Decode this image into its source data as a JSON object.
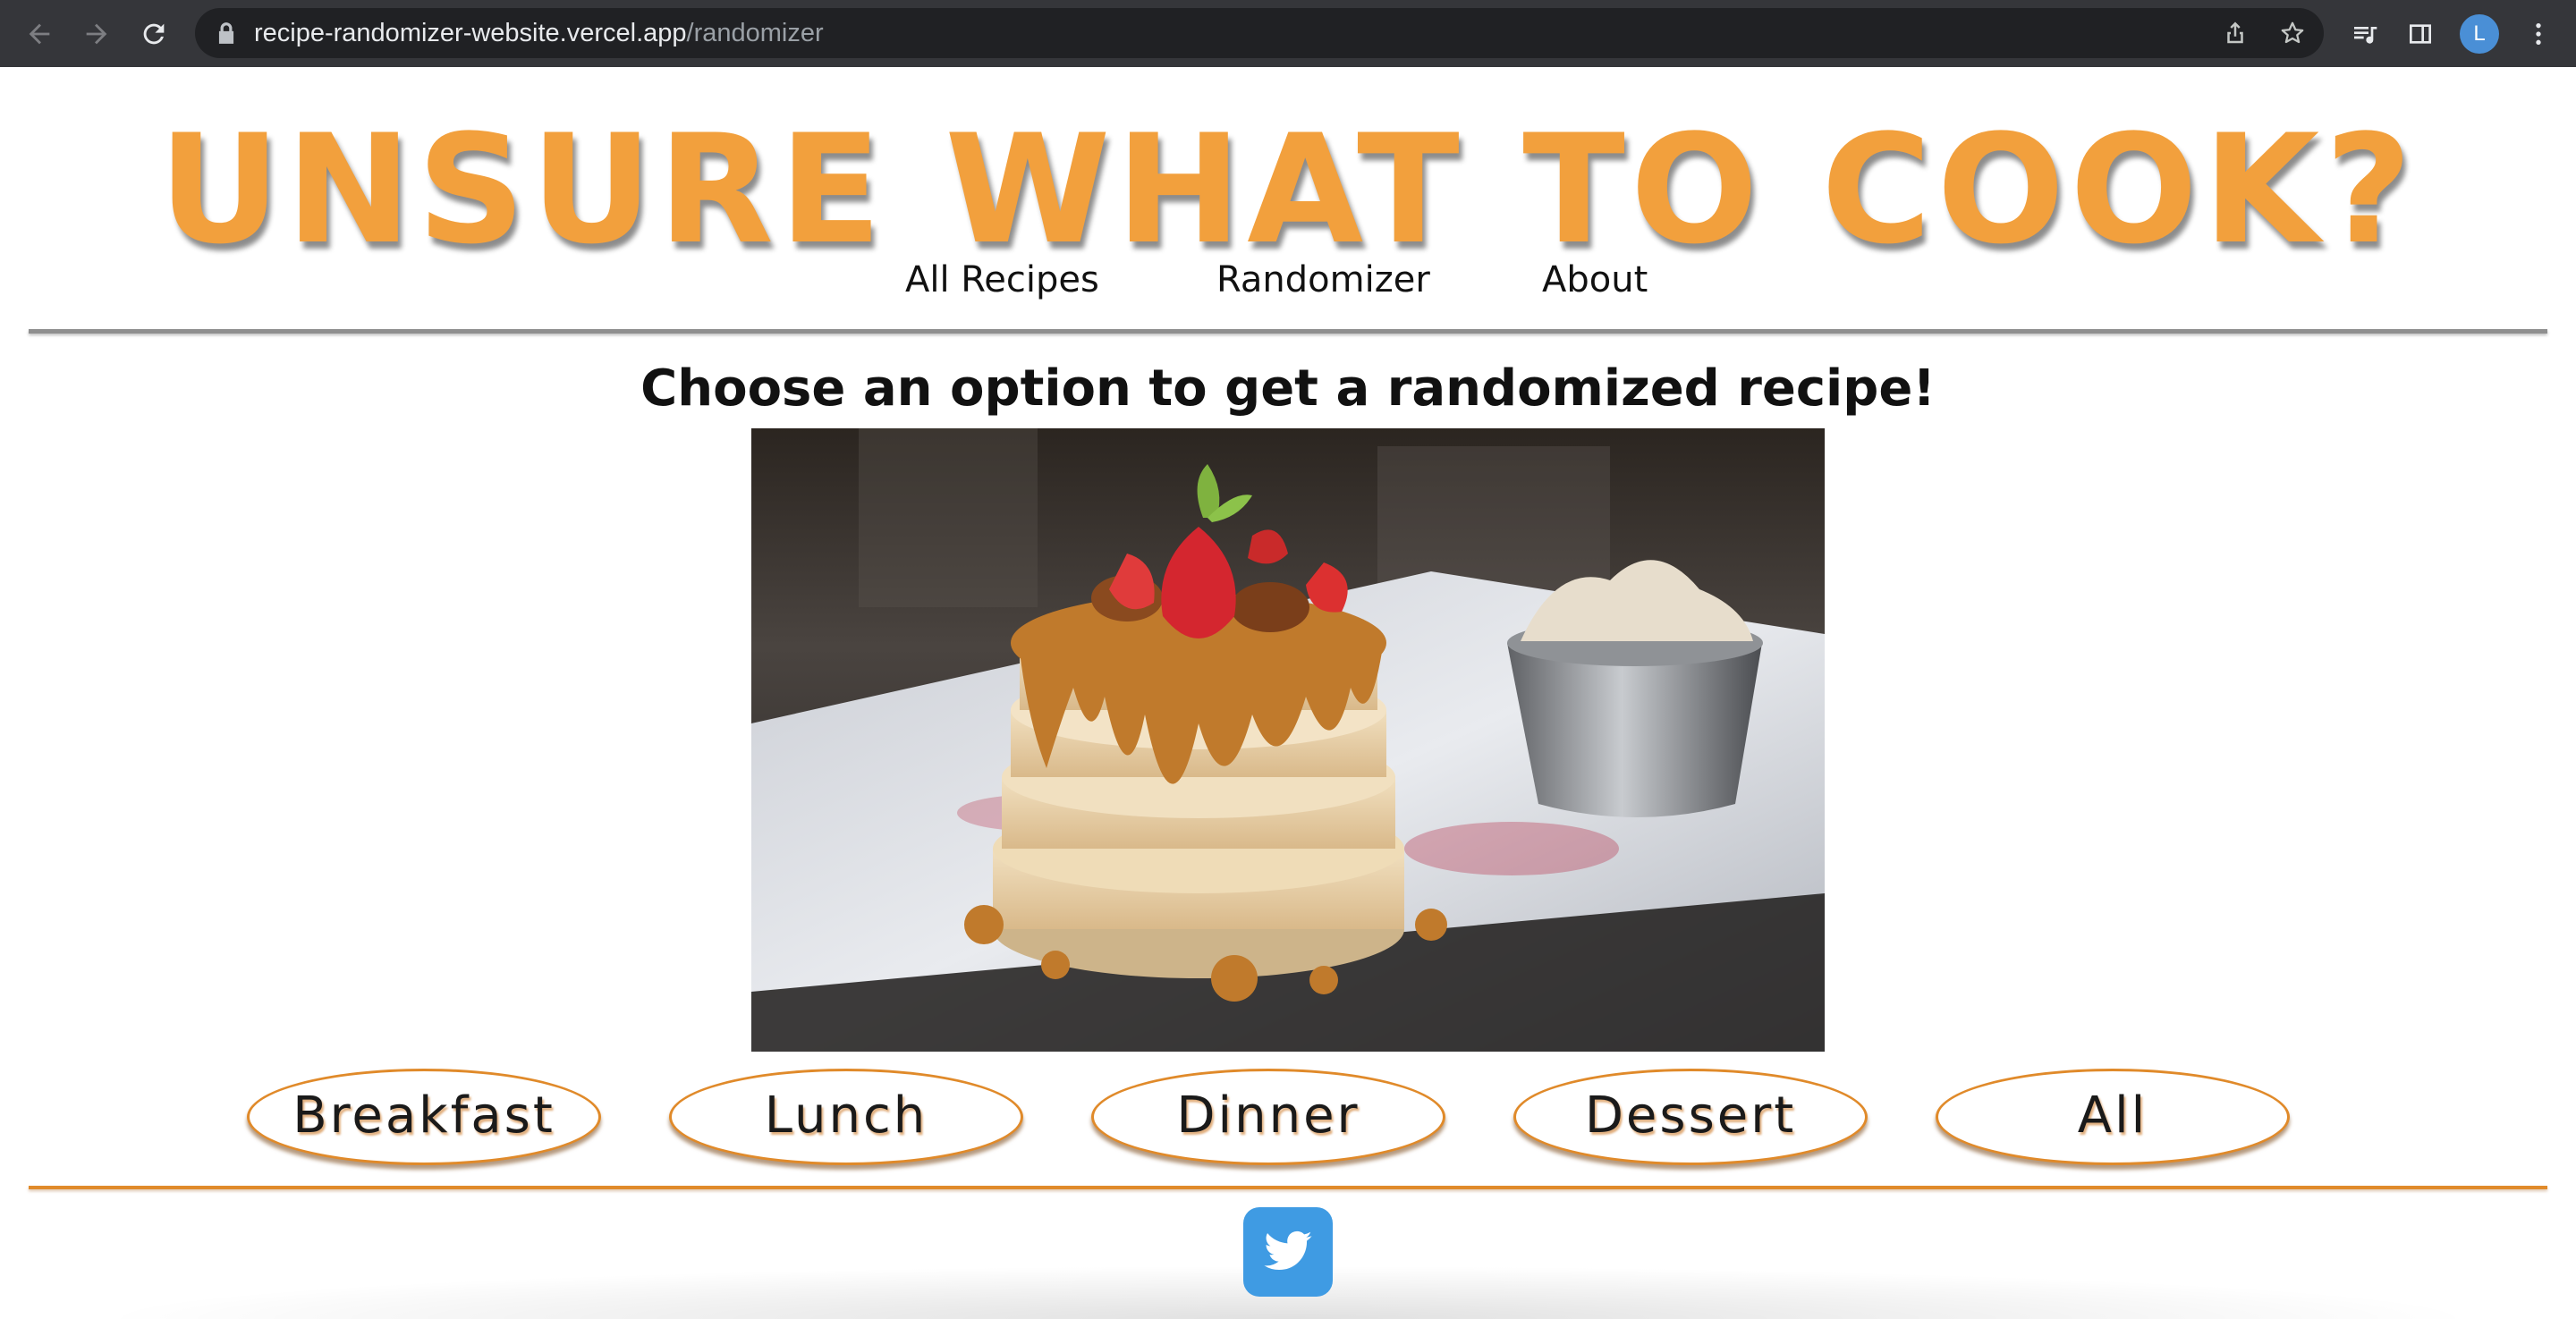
{
  "browser": {
    "url_host": "recipe-randomizer-website.vercel.app",
    "url_path": "/randomizer",
    "profile_initial": "L",
    "icons": {
      "back": "arrow-left-icon",
      "forward": "arrow-right-icon",
      "reload": "reload-icon",
      "lock": "lock-icon",
      "share": "share-icon",
      "bookmark": "star-icon",
      "media": "media-queue-icon",
      "side_panel": "side-panel-icon",
      "menu": "kebab-menu-icon"
    },
    "colors": {
      "toolbar": "#35363a",
      "omnibox": "#202124",
      "avatar": "#4a8fd6"
    }
  },
  "site": {
    "title": "UNSURE WHAT TO COOK?",
    "title_color": "#f2a03d",
    "nav": [
      {
        "label": "All Recipes"
      },
      {
        "label": "Randomizer"
      },
      {
        "label": "About"
      }
    ]
  },
  "main": {
    "heading": "Choose an option to get a randomized recipe!",
    "hero_image": "pancake-stack-photo",
    "options": [
      {
        "label": "Breakfast"
      },
      {
        "label": "Lunch"
      },
      {
        "label": "Dinner"
      },
      {
        "label": "Dessert"
      },
      {
        "label": "All"
      }
    ],
    "accent_color": "#e08a2a"
  },
  "footer": {
    "social_icon": "twitter-icon",
    "social_color": "#3f9be3"
  }
}
